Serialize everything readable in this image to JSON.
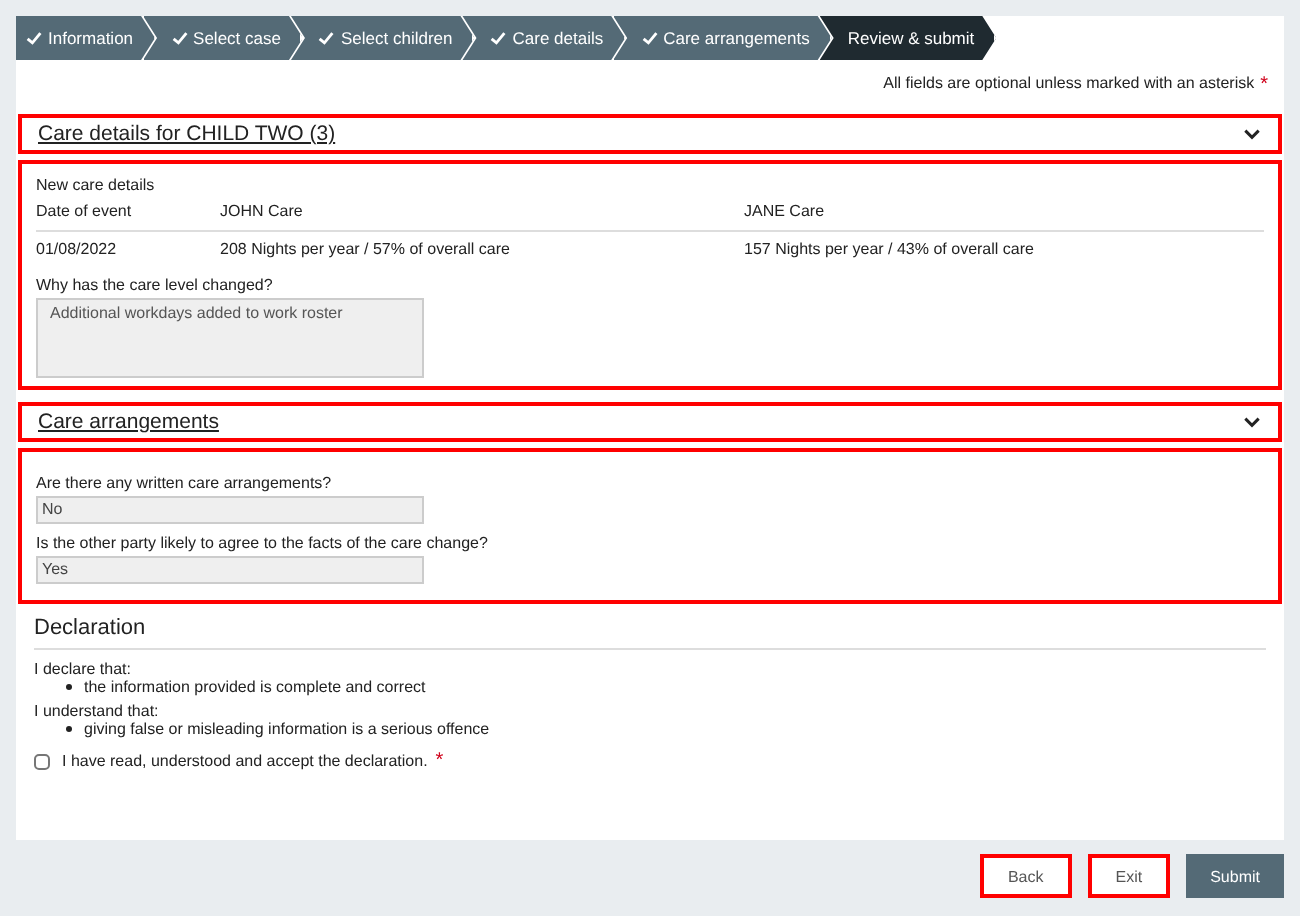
{
  "steps": [
    {
      "label": "Information",
      "done": true,
      "selected": false
    },
    {
      "label": "Select case",
      "done": true,
      "selected": false
    },
    {
      "label": "Select children",
      "done": true,
      "selected": false
    },
    {
      "label": "Care details",
      "done": true,
      "selected": false
    },
    {
      "label": "Care arrangements",
      "done": true,
      "selected": false
    },
    {
      "label": "Review & submit",
      "done": false,
      "selected": true
    }
  ],
  "notice": {
    "text": "All fields are optional unless marked with an asterisk",
    "required_mark": "*"
  },
  "care_details": {
    "header": {
      "title": "Care details for CHILD TWO (3)",
      "expanded": true,
      "highlighted": true
    },
    "body_highlighted": true,
    "subtitle": "New care details",
    "columns": [
      "Date of event",
      "JOHN Care",
      "JANE Care"
    ],
    "rows": [
      [
        "01/08/2022",
        "208 Nights per year / 57% of overall care",
        "157 Nights per year / 43% of overall care"
      ]
    ],
    "reason": {
      "label": "Why has the care level changed?",
      "value": "Additional workdays added to work roster"
    }
  },
  "care_arrangements": {
    "header": {
      "title": "Care arrangements",
      "expanded": true,
      "highlighted": true
    },
    "body_highlighted": true,
    "questions": [
      {
        "label": "Are there any written care arrangements?",
        "value": "No"
      },
      {
        "label": "Is the other party likely to agree to the facts of the care change?",
        "value": "Yes"
      }
    ]
  },
  "declaration": {
    "title": "Declaration",
    "statements": [
      {
        "intro": "I declare that:",
        "points": [
          "the information provided is complete and correct"
        ]
      },
      {
        "intro": "I understand that:",
        "points": [
          "giving false or misleading information is a serious offence"
        ]
      }
    ],
    "acceptance": {
      "label": "I have read, understood and accept the declaration.",
      "required_mark": "*",
      "checked": false
    }
  },
  "buttons": [
    {
      "label": "Back",
      "kind": "secondary",
      "highlighted": true
    },
    {
      "label": "Exit",
      "kind": "secondary",
      "highlighted": true
    },
    {
      "label": "Submit",
      "kind": "primary",
      "highlighted": false
    }
  ]
}
